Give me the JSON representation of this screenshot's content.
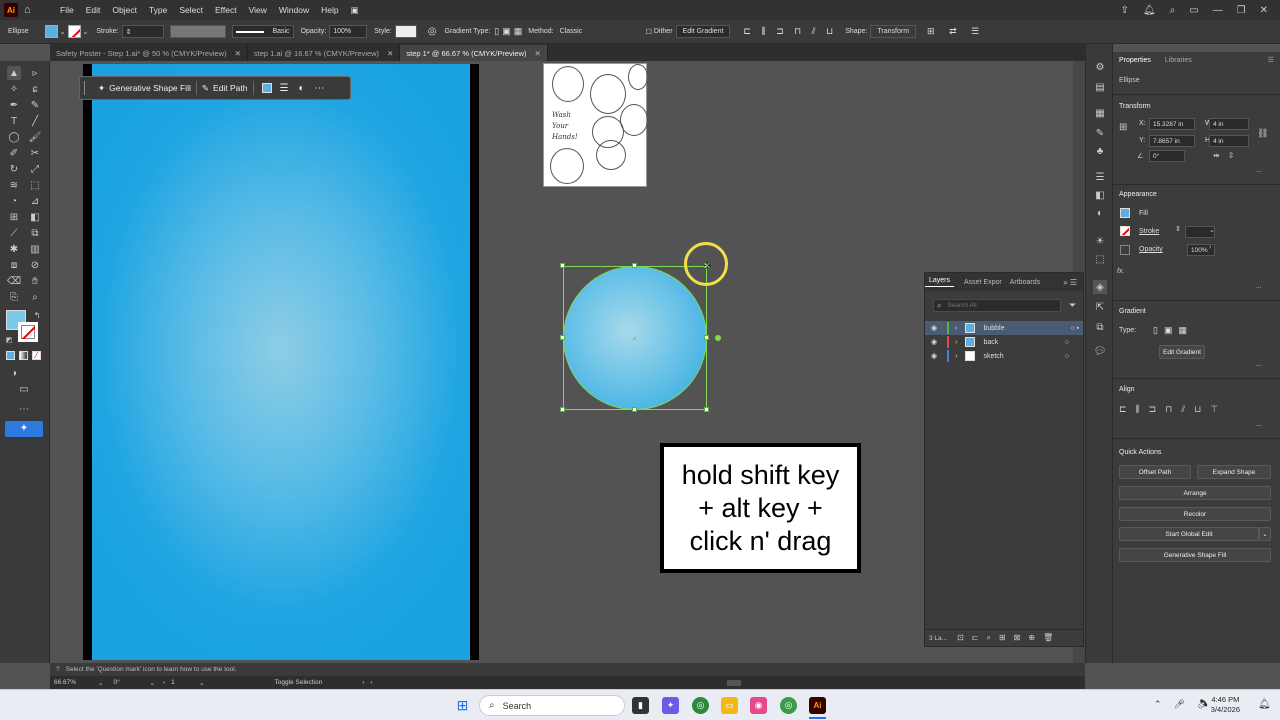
{
  "app": {
    "logo": "Ai",
    "menu": [
      "File",
      "Edit",
      "Object",
      "Type",
      "Select",
      "Effect",
      "View",
      "Window",
      "Help"
    ]
  },
  "control": {
    "object_type": "Ellipse",
    "stroke_label": "Stroke:",
    "brush": "Basic",
    "opacity_label": "Opacity:",
    "opacity_value": "100%",
    "style_label": "Style:",
    "gradient_type_label": "Gradient Type:",
    "method_label": "Method:",
    "method_value": "Classic",
    "dither_label": "Dither",
    "edit_gradient": "Edit Gradient",
    "shape_label": "Shape:",
    "transform_label": "Transform"
  },
  "tabs": [
    {
      "label": "Safety Poster - Step 1.ai* @ 50 % (CMYK/Preview)",
      "close": "✕"
    },
    {
      "label": "step 1.ai @ 16.67 % (CMYK/Preview)",
      "close": "✕"
    },
    {
      "label": "step 1* @ 66.67 % (CMYK/Preview)",
      "close": "✕"
    }
  ],
  "context_bar": {
    "generative": "Generative Shape Fill",
    "edit_path": "Edit Path"
  },
  "callout": {
    "line1": "hold shift key",
    "line2": "+ alt key +",
    "line3": "click n' drag"
  },
  "sketch": {
    "text1": "Wash",
    "text2": "Your",
    "text3": "Hands!"
  },
  "layers": {
    "tabs": [
      "Layers",
      "Asset Expor",
      "Artboards"
    ],
    "search_placeholder": "Search All",
    "rows": [
      {
        "name": "bubble",
        "color": "#4cbb30"
      },
      {
        "name": "back",
        "color": "#e04a4a"
      },
      {
        "name": "sketch",
        "color": "#4a7de0"
      }
    ],
    "count": "3 La..."
  },
  "props": {
    "tabs": [
      "Properties",
      "Libraries"
    ],
    "object": "Ellipse",
    "transform_title": "Transform",
    "x_label": "X:",
    "x_value": "15.3287 in",
    "y_label": "Y:",
    "y_value": "7.8657 in",
    "w_label": "W:",
    "w_value": "4 in",
    "h_label": "H:",
    "h_value": "4 in",
    "angle": "0°",
    "appearance_title": "Appearance",
    "fill_label": "Fill",
    "stroke_label": "Stroke",
    "opacity_label": "Opacity",
    "opacity_value": "100%",
    "fx": "fx.",
    "gradient_title": "Gradient",
    "type_label": "Type:",
    "edit_gradient": "Edit Gradient",
    "align_title": "Align",
    "quick_title": "Quick Actions",
    "offset_path": "Offset Path",
    "expand_shape": "Expand Shape",
    "arrange": "Arrange",
    "recolor": "Recolor",
    "start_global": "Start Global Edit",
    "generative": "Generative Shape Fill"
  },
  "hint": "Select the 'Question mark' icon to learn how to use the tool.",
  "status": {
    "zoom": "66.67%",
    "rotation": "0°",
    "artboard": "1",
    "tool": "Toggle Selection"
  },
  "taskbar": {
    "search": "Search",
    "time": "4:46 PM",
    "date": "3/4/2026"
  }
}
